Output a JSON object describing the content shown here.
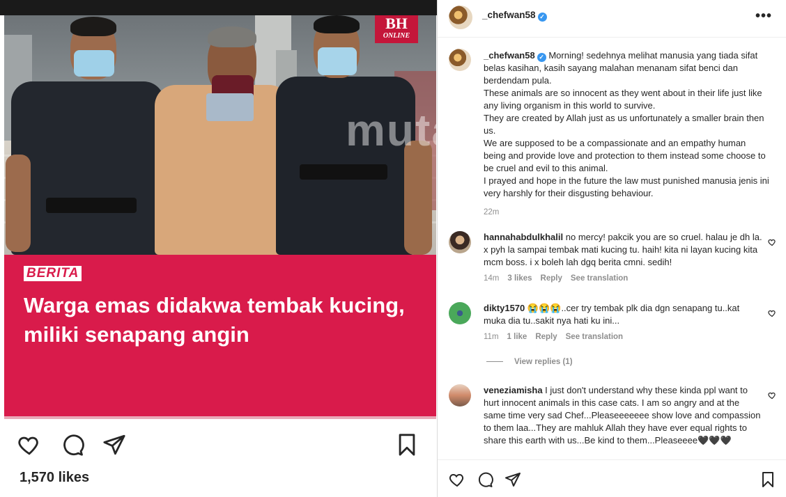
{
  "photo": {
    "logo_main": "BH",
    "logo_sub": "ONLINE",
    "watermark": "mutai",
    "banner_tag": "BERITA",
    "banner_headline": "Warga emas didakwa tembak kucing, miliki senapang angin"
  },
  "post_actions": {
    "like_icon": "heart-icon",
    "comment_icon": "comment-icon",
    "share_icon": "share-icon",
    "save_icon": "bookmark-icon"
  },
  "likes_text": "1,570 likes",
  "header": {
    "username": "_chefwan58",
    "verified_mark": "✓",
    "more_icon": "more-icon",
    "more_glyph": "•••"
  },
  "caption": {
    "username": "_chefwan58",
    "verified_mark": "✓",
    "lines": [
      "Morning! sedehnya melihat manusia yang tiada sifat belas kasihan, kasih sayang malahan menanam sifat benci dan berdendam pula.",
      "These animals are so innocent as they went about in their life just like any living organism in this world to survive.",
      "They are created by Allah just as us unfortunately a smaller brain then us.",
      "We are supposed to be a compassionate and an empathy human being and provide love and protection to them instead some choose to be cruel and evil to this animal.",
      "I prayed and hope in the future the law must punished manusia jenis ini very harshly for their disgusting behaviour."
    ],
    "time": "22m"
  },
  "comments": [
    {
      "username": "hannahabdulkhalil",
      "text": "no mercy! pakcik you are so cruel. halau je dh la. x pyh la sampai tembak mati kucing tu. haih! kita ni layan kucing kita mcm boss. i x boleh lah dgq berita cmni. sedih!",
      "time": "14m",
      "likes": "3 likes",
      "reply": "Reply",
      "translate": "See translation"
    },
    {
      "username": "dikty1570",
      "text": "😭😭😭..cer try tembak plk dia dgn senapang tu..kat muka dia tu..sakit nya hati ku ini...",
      "time": "11m",
      "likes": "1 like",
      "reply": "Reply",
      "translate": "See translation"
    },
    {
      "username": "veneziamisha",
      "text": "I just don't understand why these kinda ppl want to hurt innocent animals in this case cats. I am so angry and at the same time very sad Chef...Pleaseeeeeee show love and compassion to them laa...They are mahluk Allah they have ever equal rights to share this earth with us...Be kind to them...Pleaseeee🖤🖤🖤"
    }
  ],
  "view_replies": "View replies (1)",
  "colors": {
    "banner": "#d91b4b",
    "verified": "#3897f0",
    "muted": "#8e8e8e"
  }
}
